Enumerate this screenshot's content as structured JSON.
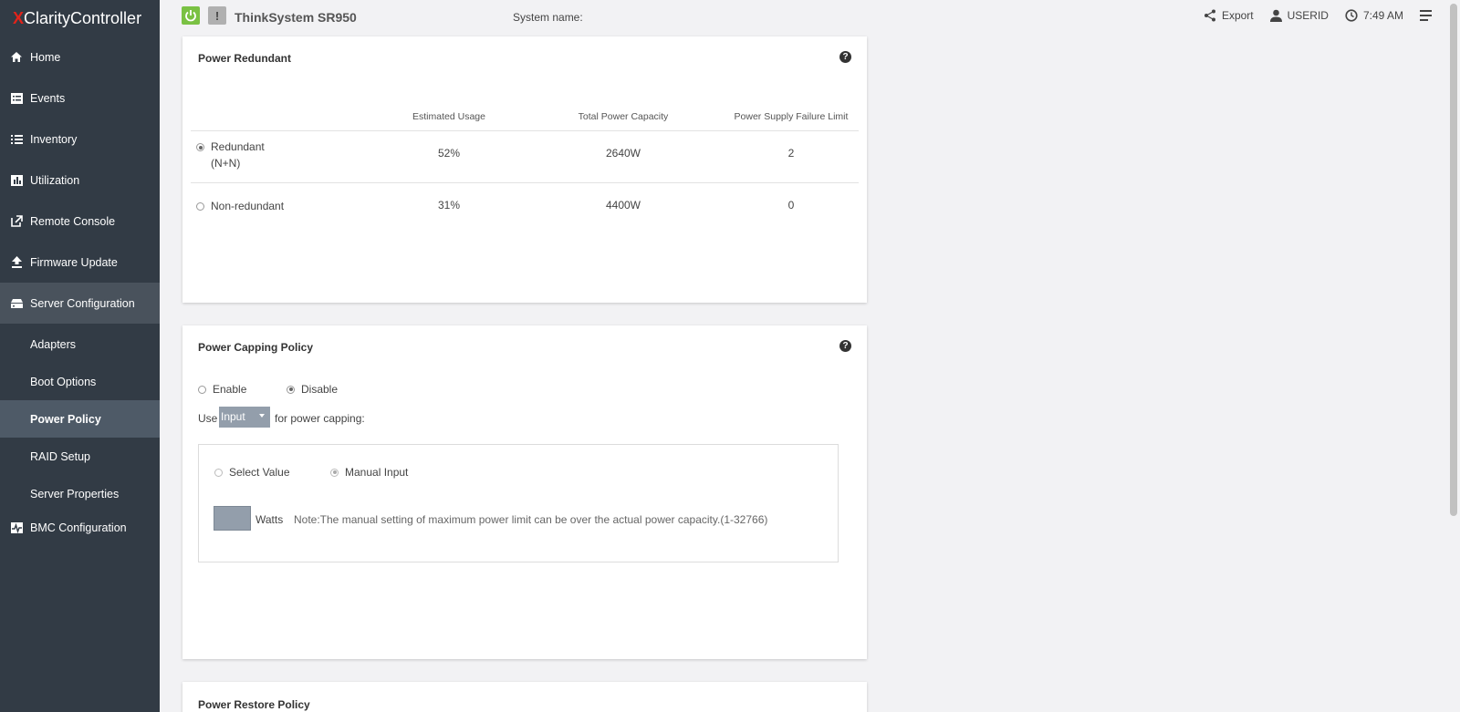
{
  "brand": {
    "prefix": "X",
    "rest": "Clarity",
    "suffix": " Controller"
  },
  "sidebar": {
    "items": [
      {
        "label": "Home",
        "icon": "home-icon"
      },
      {
        "label": "Events",
        "icon": "events-icon"
      },
      {
        "label": "Inventory",
        "icon": "list-icon"
      },
      {
        "label": "Utilization",
        "icon": "chart-icon"
      },
      {
        "label": "Remote Console",
        "icon": "external-link-icon"
      },
      {
        "label": "Firmware Update",
        "icon": "upload-icon"
      },
      {
        "label": "Server Configuration",
        "icon": "server-icon"
      }
    ],
    "subitems": [
      {
        "label": "Adapters"
      },
      {
        "label": "Boot Options"
      },
      {
        "label": "Power Policy"
      },
      {
        "label": "RAID Setup"
      },
      {
        "label": "Server Properties"
      }
    ],
    "bmc": {
      "label": "BMC Configuration",
      "icon": "pulse-icon"
    }
  },
  "header": {
    "warn_symbol": "!",
    "model": "ThinkSystem SR950",
    "system_name_label": "System name:",
    "export_label": "Export",
    "user_label": "USERID",
    "time": "7:49 AM"
  },
  "power_redundant": {
    "title": "Power Redundant",
    "help": "?",
    "columns": [
      "Estimated Usage",
      "Total Power Capacity",
      "Power Supply Failure Limit"
    ],
    "rows": [
      {
        "mode": "Redundant",
        "mode_sub": "(N+N)",
        "usage": "52%",
        "capacity": "2640W",
        "limit": "2",
        "selected": true
      },
      {
        "mode": "Non-redundant",
        "mode_sub": "",
        "usage": "31%",
        "capacity": "4400W",
        "limit": "0",
        "selected": false
      }
    ]
  },
  "power_capping": {
    "title": "Power Capping Policy",
    "help": "?",
    "enable_label": "Enable",
    "disable_label": "Disable",
    "use_label": "Use",
    "select_value": "Input",
    "for_label": "for power capping:",
    "select_value_label": "Select Value",
    "manual_input_label": "Manual Input",
    "watts_label": "Watts",
    "note": "Note:The manual setting of maximum power limit can be over the actual power capacity.(1-32766)"
  },
  "power_restore": {
    "title": "Power Restore Policy"
  }
}
